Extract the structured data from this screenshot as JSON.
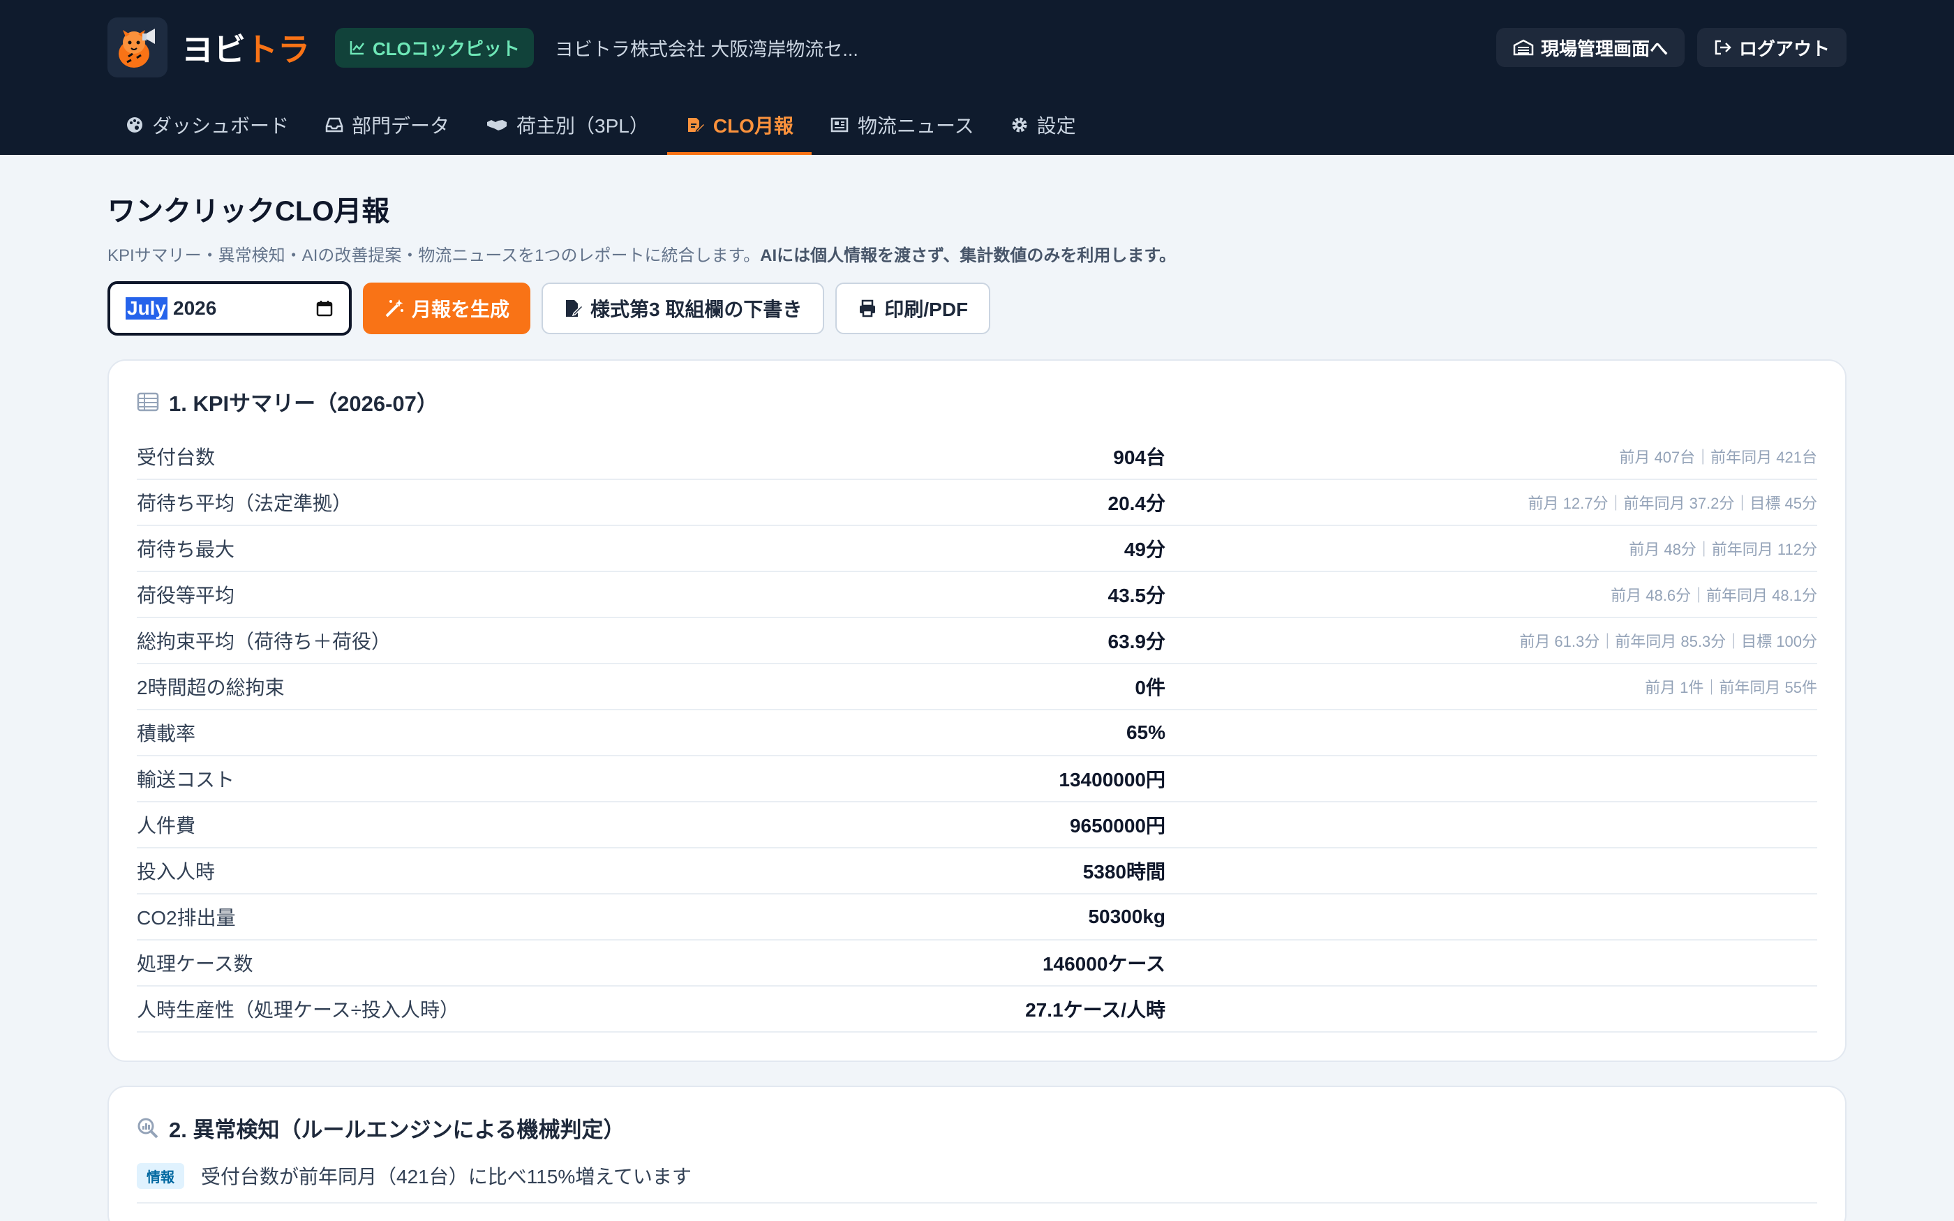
{
  "header": {
    "brand_prefix": "ヨビ",
    "brand_accent": "トラ",
    "cockpit_badge": "CLOコックピット",
    "company": "ヨビトラ株式会社 大阪湾岸物流セ...",
    "site_button": "現場管理画面へ",
    "logout_button": "ログアウト"
  },
  "nav": [
    {
      "label": "ダッシュボード",
      "icon": "palette-icon",
      "active": false
    },
    {
      "label": "部門データ",
      "icon": "inbox-icon",
      "active": false
    },
    {
      "label": "荷主別（3PL）",
      "icon": "handshake-icon",
      "active": false
    },
    {
      "label": "CLO月報",
      "icon": "edit-document-icon",
      "active": true
    },
    {
      "label": "物流ニュース",
      "icon": "newspaper-icon",
      "active": false
    },
    {
      "label": "設定",
      "icon": "gear-icon",
      "active": false
    }
  ],
  "page": {
    "title": "ワンクリックCLO月報",
    "subtitle_plain": "KPIサマリー・異常検知・AIの改善提案・物流ニュースを1つのレポートに統合します。",
    "subtitle_bold": "AIには個人情報を渡さず、集計数値のみを利用します。"
  },
  "controls": {
    "month_selected": "July",
    "month_year": "2026",
    "generate_button": "月報を生成",
    "form3_button": "様式第3 取組欄の下書き",
    "print_button": "印刷/PDF"
  },
  "kpi": {
    "title": "1. KPIサマリー（2026-07）",
    "rows": [
      {
        "label": "受付台数",
        "value": "904台",
        "comparison": "前月 407台｜前年同月 421台"
      },
      {
        "label": "荷待ち平均（法定準拠）",
        "value": "20.4分",
        "comparison": "前月 12.7分｜前年同月 37.2分｜目標 45分"
      },
      {
        "label": "荷待ち最大",
        "value": "49分",
        "comparison": "前月 48分｜前年同月 112分"
      },
      {
        "label": "荷役等平均",
        "value": "43.5分",
        "comparison": "前月 48.6分｜前年同月 48.1分"
      },
      {
        "label": "総拘束平均（荷待ち＋荷役）",
        "value": "63.9分",
        "comparison": "前月 61.3分｜前年同月 85.3分｜目標 100分"
      },
      {
        "label": "2時間超の総拘束",
        "value": "0件",
        "comparison": "前月 1件｜前年同月 55件"
      },
      {
        "label": "積載率",
        "value": "65%",
        "comparison": ""
      },
      {
        "label": "輸送コスト",
        "value": "13400000円",
        "comparison": ""
      },
      {
        "label": "人件費",
        "value": "9650000円",
        "comparison": ""
      },
      {
        "label": "投入人時",
        "value": "5380時間",
        "comparison": ""
      },
      {
        "label": "CO2排出量",
        "value": "50300kg",
        "comparison": ""
      },
      {
        "label": "処理ケース数",
        "value": "146000ケース",
        "comparison": ""
      },
      {
        "label": "人時生産性（処理ケース÷投入人時）",
        "value": "27.1ケース/人時",
        "comparison": ""
      }
    ]
  },
  "anomaly": {
    "title": "2. 異常検知（ルールエンジンによる機械判定）",
    "items": [
      {
        "badge": "情報",
        "text": "受付台数が前年同月（421台）に比べ115%増えています"
      }
    ]
  },
  "colors": {
    "header_bg": "#0f1b2d",
    "accent": "#f97316",
    "page_bg": "#f1f5f9"
  }
}
